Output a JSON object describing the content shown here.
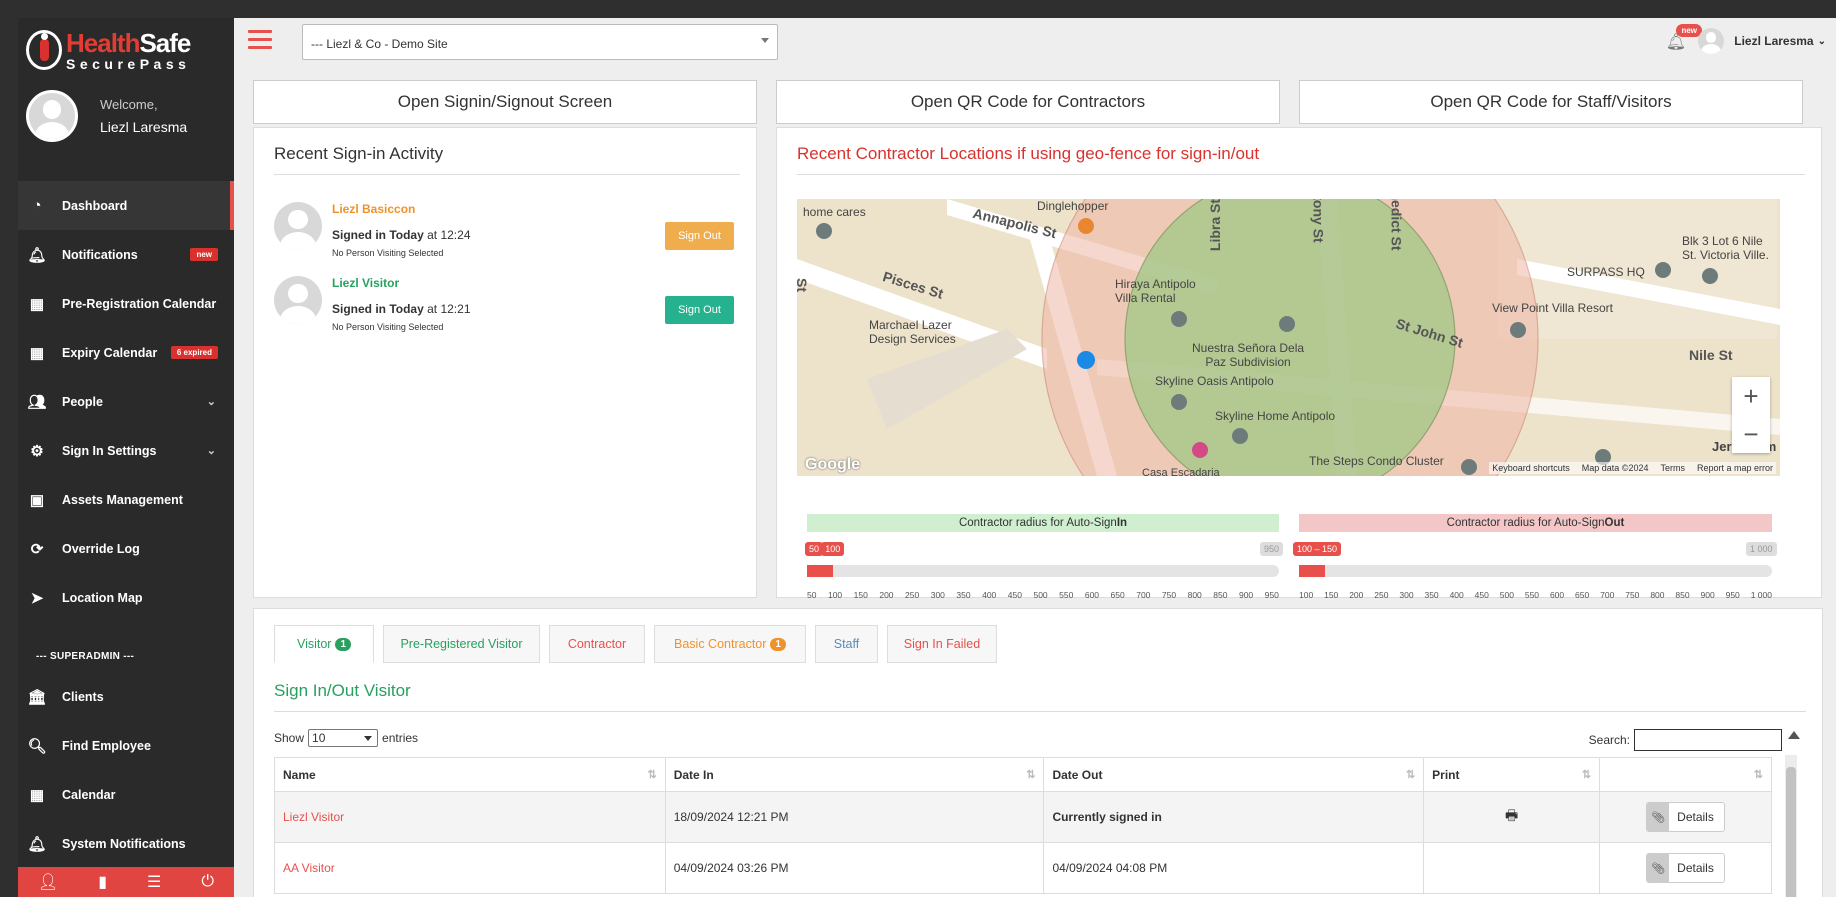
{
  "brand": {
    "name_a": "Health",
    "name_b": "Safe",
    "sub": "SecurePass"
  },
  "user": {
    "welcome": "Welcome,",
    "name": "Liezl Laresma"
  },
  "sidebar": {
    "items": [
      {
        "label": "Dashboard",
        "icon": "dashboard-icon"
      },
      {
        "label": "Notifications",
        "badge": "new",
        "icon": "bell-icon"
      },
      {
        "label": "Pre-Registration Calendar",
        "icon": "calendar-icon"
      },
      {
        "label": "Expiry Calendar",
        "badge": "6 expired",
        "icon": "calendar-icon"
      },
      {
        "label": "People",
        "icon": "users-icon"
      },
      {
        "label": "Sign In Settings",
        "icon": "gear-icon"
      },
      {
        "label": "Assets Management",
        "icon": "archive-icon"
      },
      {
        "label": "Override Log",
        "icon": "refresh-icon"
      },
      {
        "label": "Location Map",
        "icon": "location-arrow-icon"
      }
    ],
    "superadmin_label": "--- SUPERADMIN ---",
    "admin_items": [
      {
        "label": "Clients",
        "icon": "bank-icon"
      },
      {
        "label": "Find Employee",
        "icon": "search-icon"
      },
      {
        "label": "Calendar",
        "icon": "calendar-icon"
      },
      {
        "label": "System Notifications",
        "icon": "bell-icon"
      }
    ]
  },
  "topbar": {
    "site": "--- Liezl & Co - Demo Site",
    "bell_badge": "new",
    "user_name": "Liezl Laresma"
  },
  "quick_buttons": [
    "Open Signin/Signout Screen",
    "Open QR Code for Contractors",
    "Open QR Code for Staff/Visitors"
  ],
  "recent": {
    "title": "Recent Sign-in Activity",
    "items": [
      {
        "name": "Liezl Basiccon",
        "signed": "Signed in Today",
        "at": " at 12:24",
        "note": "No Person Visiting Selected",
        "button": "Sign Out",
        "color": "#f0ad4e"
      },
      {
        "name": "Liezl Visitor",
        "signed": "Signed in Today",
        "at": " at 12:21",
        "note": "No Person Visiting Selected",
        "button": "Sign Out",
        "color": "#26b18f"
      }
    ]
  },
  "geo": {
    "title": "Recent Contractor Locations if using geo-fence for sign-in/out",
    "map_labels": {
      "home_cares": "home cares",
      "dinglehopper": "Dinglehopper",
      "annapolis": "Annapolis St",
      "pisces": "Pisces St",
      "libra": "Libra St",
      "tony": "tony St",
      "benedict": "nedict St",
      "st_john": "St John St",
      "nile": "Nile St",
      "marchael": "Marchael Lazer\nDesign Services",
      "hiraya": "Hiraya Antipolo\nVilla Rental",
      "nuestra": "Nuestra Señora Dela\nPaz Subdivision",
      "skyline_oasis": "Skyline Oasis Antipolo",
      "skyline_home": "Skyline Home Antipolo",
      "surpass": "SURPASS HQ",
      "view_point": "View Point Villa Resort",
      "blk3": "Blk 3 Lot 6 Nile\nSt. Victoria Ville.",
      "steps": "The Steps Condo Cluster",
      "casa": "Casa Escadaria",
      "jeru": "Jerusalem",
      "st_left": "St"
    },
    "google": "Google",
    "attribution": [
      "Keyboard shortcuts",
      "Map data ©2024",
      "Terms",
      "Report a map error"
    ],
    "signin_label_a": "Contractor radius for Auto-Sign",
    "signin_label_b": "In",
    "signout_label_a": "Contractor radius for Auto-Sign",
    "signout_label_b": "Out",
    "signin_slider": {
      "from": "50",
      "to": "100",
      "max": "950",
      "from_value": 50,
      "to_value": 100,
      "min": 50,
      "max_value": 950
    },
    "signout_slider": {
      "label": "100 – 150",
      "max": "1 000",
      "from_value": 100,
      "to_value": 150,
      "min": 100,
      "max_value": 1000
    },
    "signin_ticks": [
      "50",
      "100",
      "150",
      "200",
      "250",
      "300",
      "350",
      "400",
      "450",
      "500",
      "550",
      "600",
      "650",
      "700",
      "750",
      "800",
      "850",
      "900",
      "950"
    ],
    "signout_ticks": [
      "100",
      "150",
      "200",
      "250",
      "300",
      "350",
      "400",
      "450",
      "500",
      "550",
      "600",
      "650",
      "700",
      "750",
      "800",
      "850",
      "900",
      "950",
      "1 000"
    ]
  },
  "tabs": [
    {
      "label": "Visitor",
      "badge": "1",
      "color": "#27a060",
      "badge_color": "#27a060"
    },
    {
      "label": "Pre-Registered Visitor",
      "color": "#27a060"
    },
    {
      "label": "Contractor",
      "color": "#e8504c"
    },
    {
      "label": "Basic Contractor",
      "badge": "1",
      "color": "#f0922b",
      "badge_color": "#f0922b"
    },
    {
      "label": "Staff",
      "color": "#5b8db8"
    },
    {
      "label": "Sign In Failed",
      "color": "#e8504c"
    }
  ],
  "visitor_table": {
    "title": "Sign In/Out Visitor",
    "show_label": "Show",
    "show_value": "10",
    "entries_label": "entries",
    "search_label": "Search:",
    "columns": [
      "Name",
      "Date In",
      "Date Out",
      "Print",
      ""
    ],
    "rows": [
      {
        "name": "Liezl Visitor",
        "date_in": "18/09/2024 12:21 PM",
        "date_out": "Currently signed in",
        "print": true,
        "action": "Details"
      },
      {
        "name": "AA Visitor",
        "date_in": "04/09/2024 03:26 PM",
        "date_out": "04/09/2024 04:08 PM",
        "print": false,
        "action": "Details"
      }
    ]
  }
}
